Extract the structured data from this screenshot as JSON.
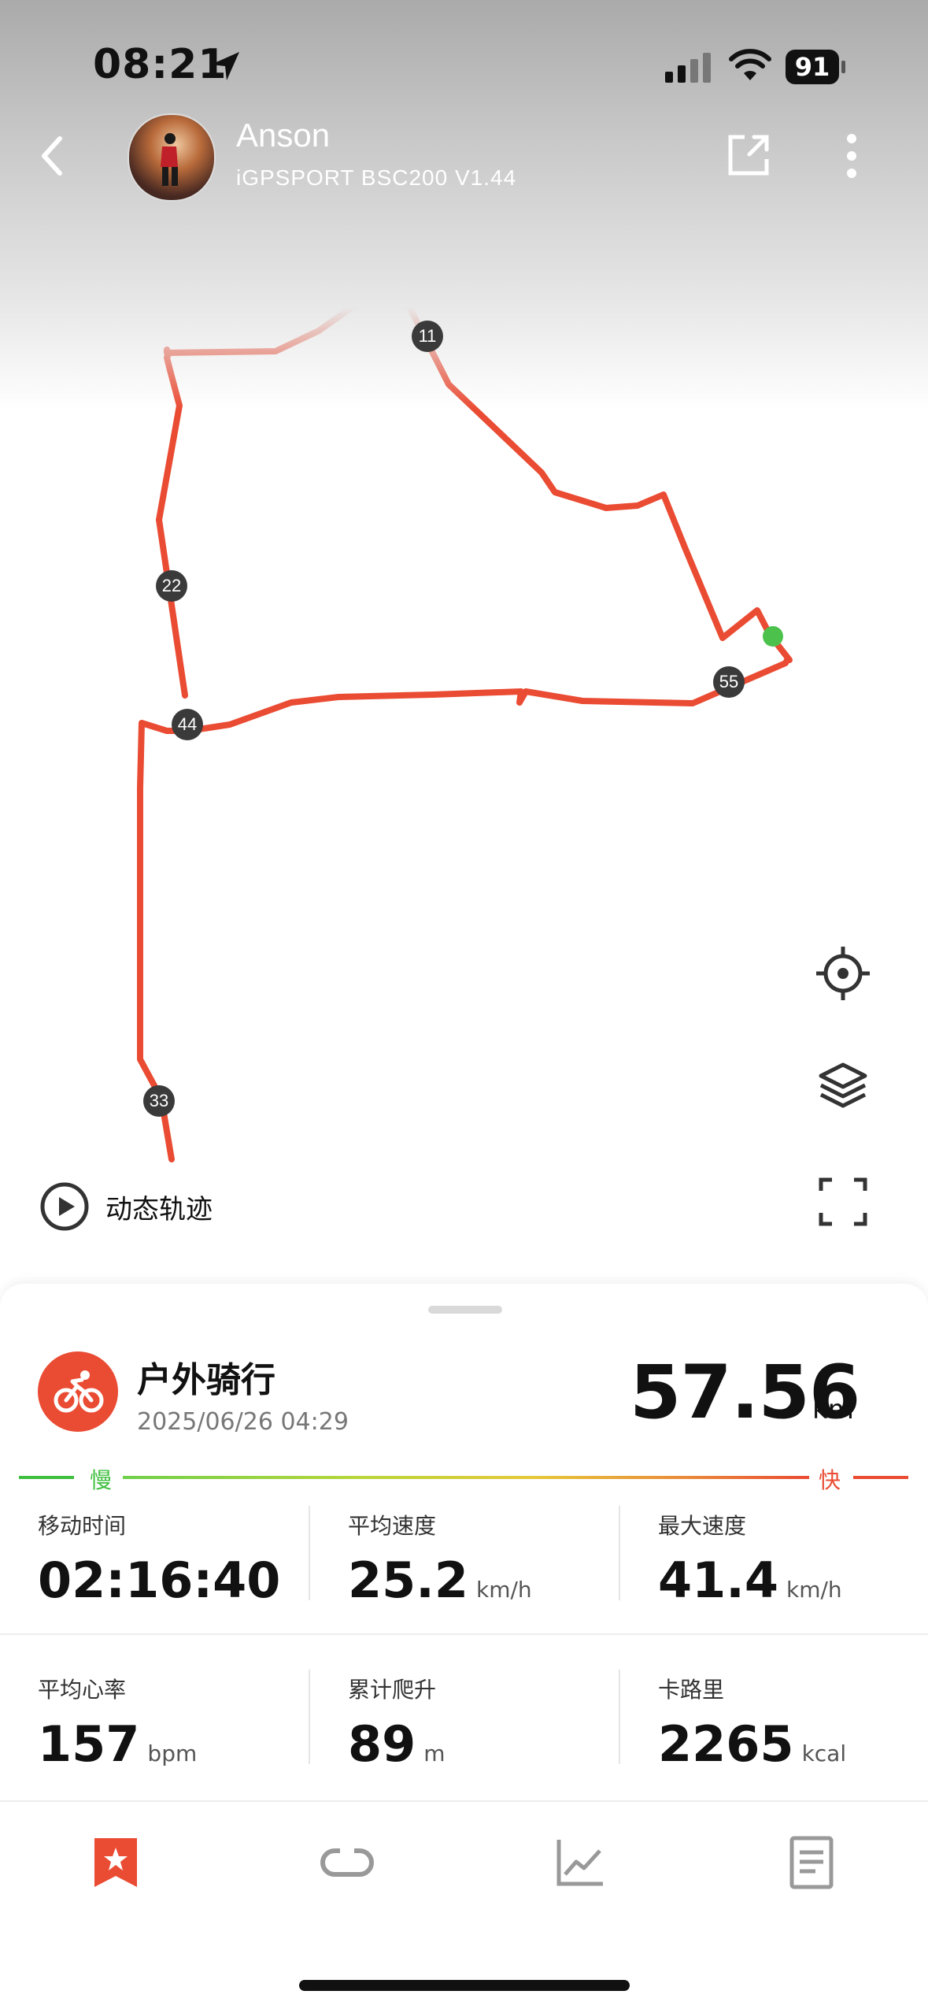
{
  "status_bar": {
    "time": "08:21",
    "battery": "91"
  },
  "header": {
    "user_name": "Anson",
    "device": "iGPSPORT BSC200 V1.44"
  },
  "map": {
    "km_markers": [
      "11",
      "22",
      "44",
      "55",
      "33"
    ],
    "playback_label": "动态轨迹"
  },
  "activity": {
    "type": "户外骑行",
    "datetime": "2025/06/26 04:29",
    "distance": "57.56",
    "distance_unit": "km",
    "speed_legend": {
      "slow": "慢",
      "fast": "快"
    }
  },
  "stats": [
    {
      "label": "移动时间",
      "value": "02:16:40",
      "unit": ""
    },
    {
      "label": "平均速度",
      "value": "25.2",
      "unit": "km/h"
    },
    {
      "label": "最大速度",
      "value": "41.4",
      "unit": "km/h"
    },
    {
      "label": "平均心率",
      "value": "157",
      "unit": "bpm"
    },
    {
      "label": "累计爬升",
      "value": "89",
      "unit": "m"
    },
    {
      "label": "卡路里",
      "value": "2265",
      "unit": "kcal"
    }
  ],
  "colors": {
    "accent": "#ea4b33",
    "route": "#ea4b33",
    "slow": "#3fbf3f",
    "start_dot": "#4cc24c"
  },
  "tabs": [
    "summary-icon",
    "laps-icon",
    "chart-icon",
    "details-icon"
  ]
}
